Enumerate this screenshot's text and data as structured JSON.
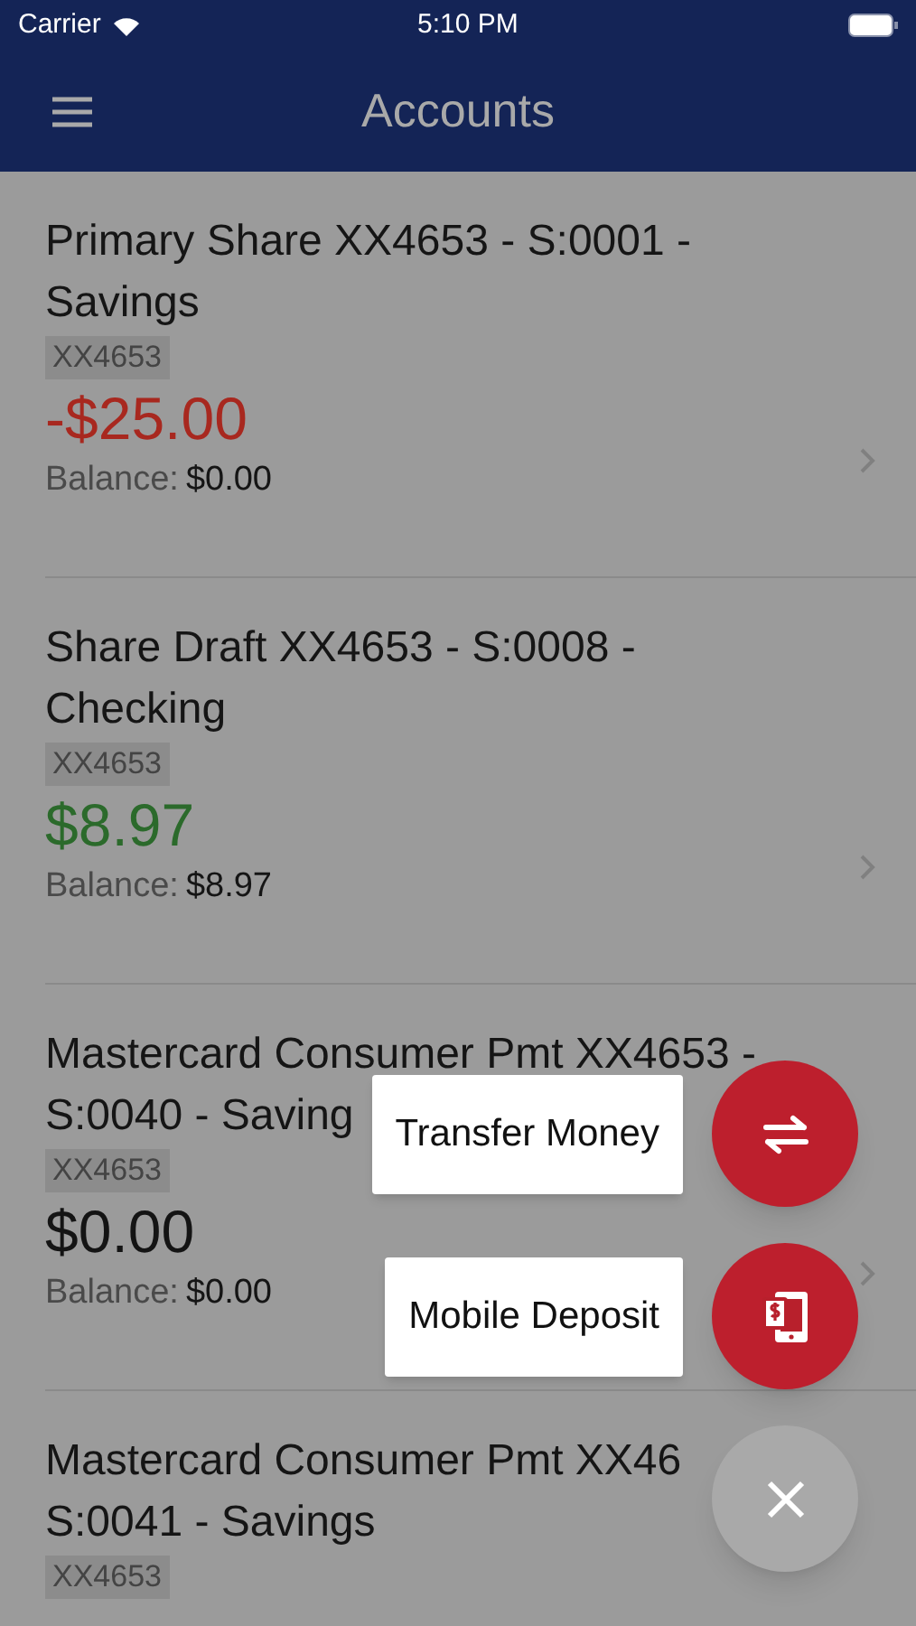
{
  "status_bar": {
    "carrier": "Carrier",
    "time": "5:10 PM"
  },
  "header": {
    "title": "Accounts"
  },
  "accounts": [
    {
      "title_lines": [
        "Primary Share XX4653 - S:0001 -",
        "Savings"
      ],
      "tag": "XX4653",
      "amount": "-$25.00",
      "color": "#a8281f",
      "balance_label": "Balance:",
      "balance": "$0.00"
    },
    {
      "title_lines": [
        "Share Draft XX4653 - S:0008 -",
        "Checking"
      ],
      "tag": "XX4653",
      "amount": "$8.97",
      "color": "#2b6a2b",
      "balance_label": "Balance:",
      "balance": "$8.97"
    },
    {
      "title_lines": [
        "Mastercard Consumer Pmt XX4653 -",
        "S:0040 - Saving"
      ],
      "tag": "XX4653",
      "amount": "$0.00",
      "color": "#141414",
      "balance_label": "Balance:",
      "balance": "$0.00"
    },
    {
      "title_lines": [
        "Mastercard Consumer Pmt XX46",
        "S:0041 - Savings"
      ],
      "tag": "XX4653"
    }
  ],
  "fab_menu": {
    "actions": [
      {
        "label": "Transfer Money",
        "kind": "transfer"
      },
      {
        "label": "Mobile Deposit",
        "kind": "deposit"
      }
    ]
  }
}
